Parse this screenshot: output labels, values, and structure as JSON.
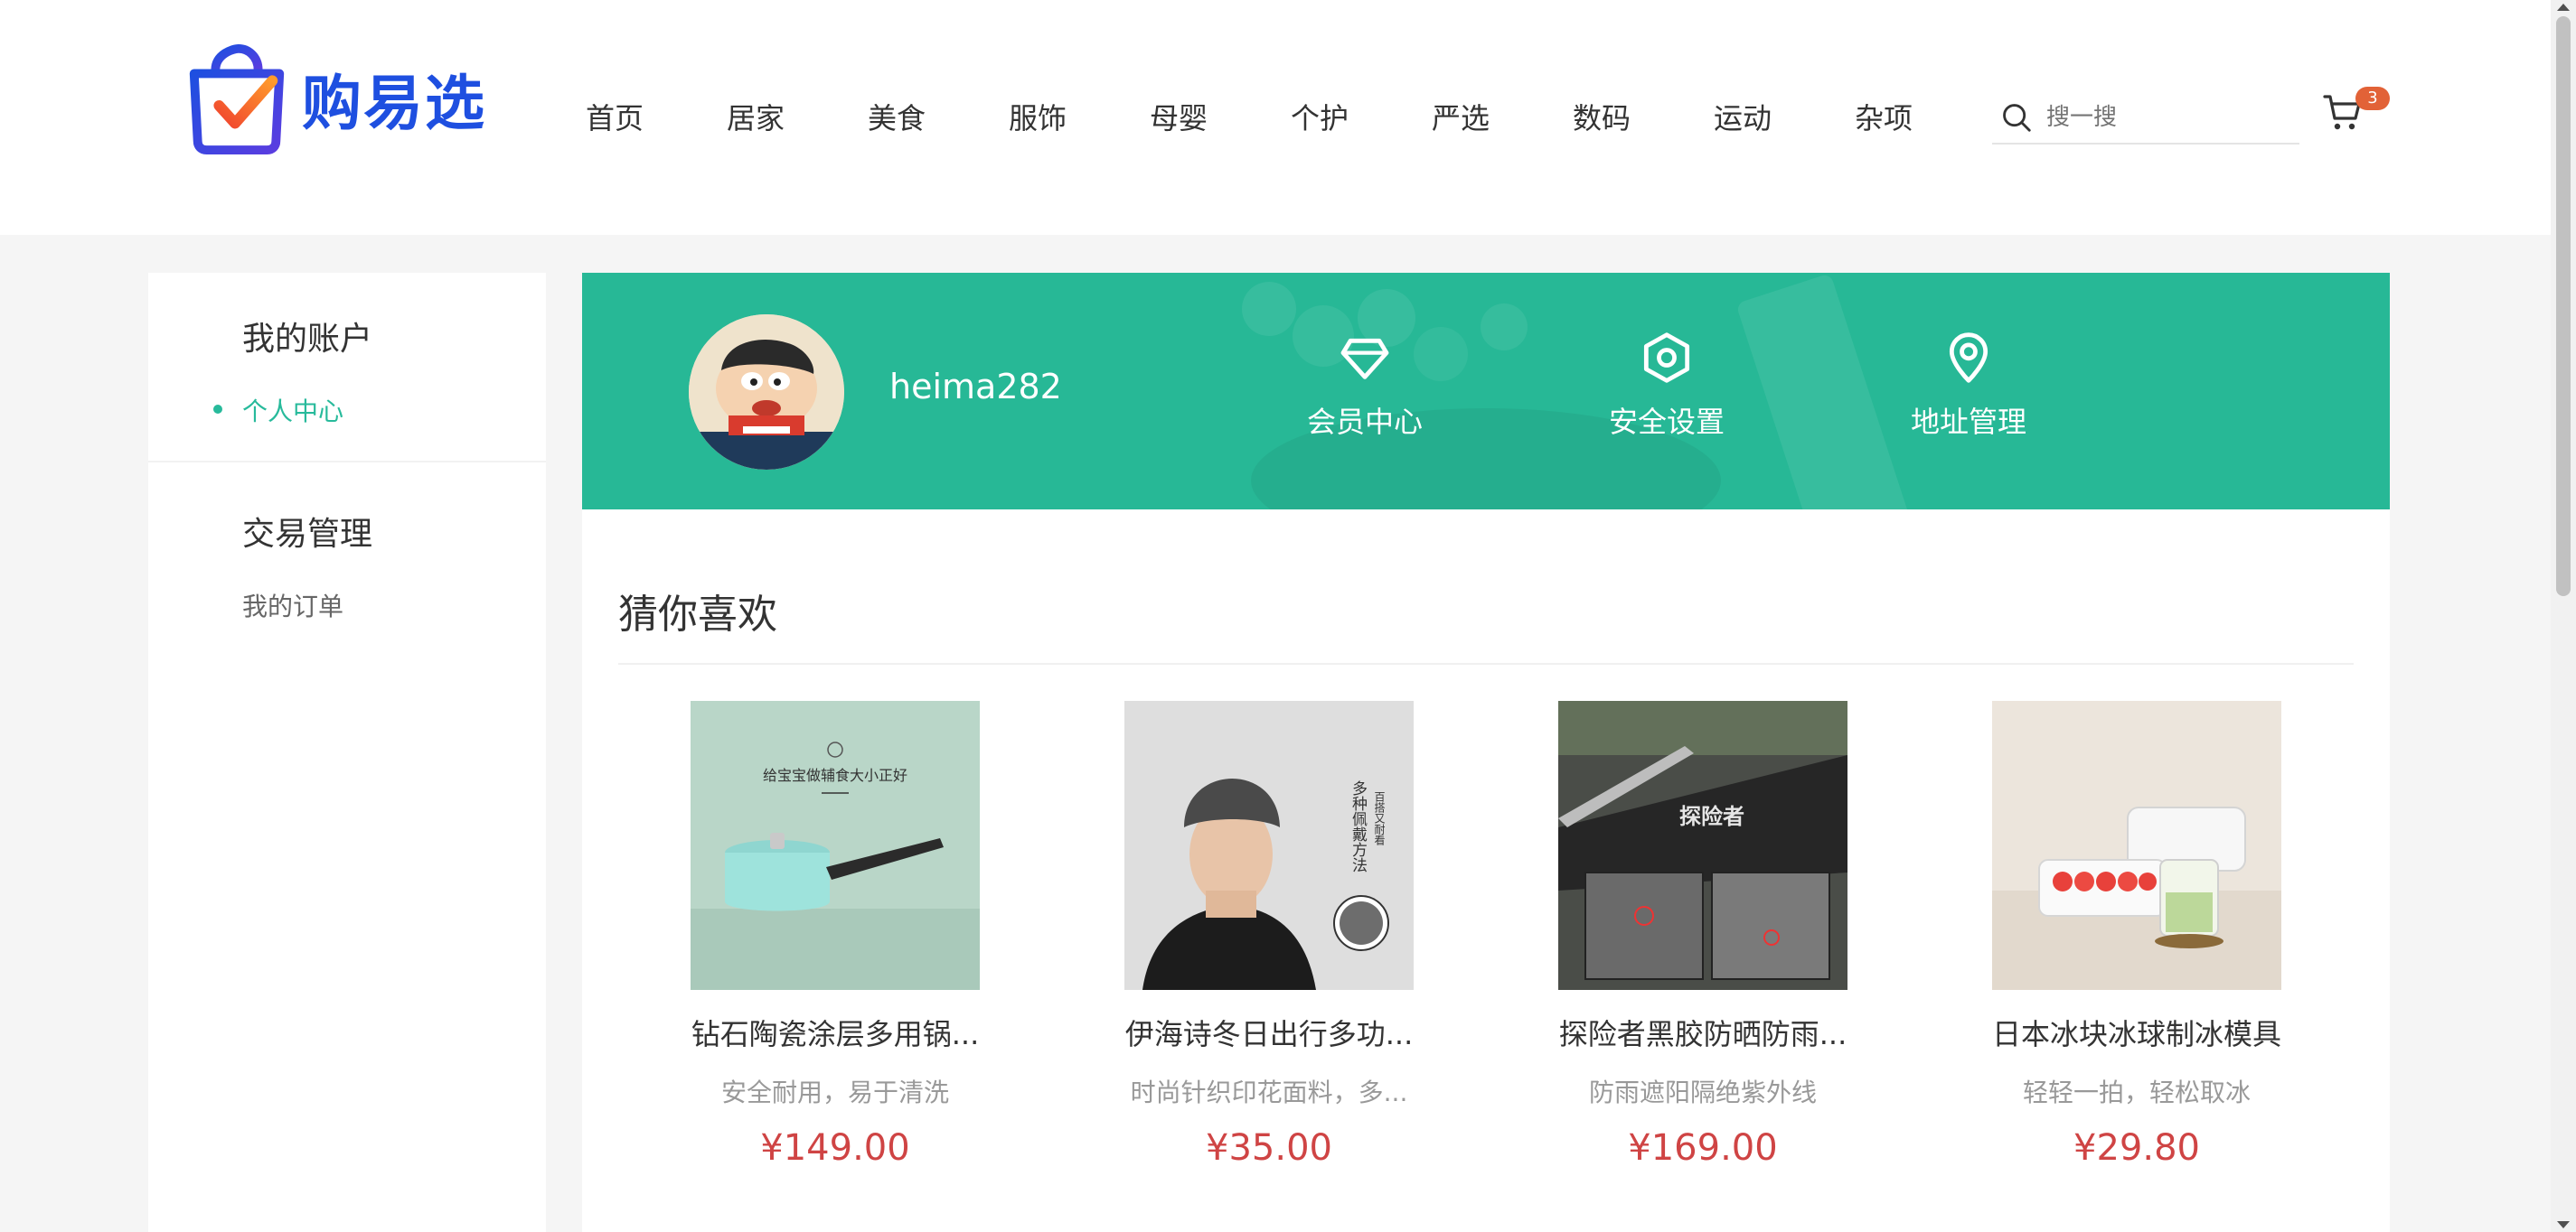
{
  "brand": {
    "name": "购易选"
  },
  "nav": [
    "首页",
    "居家",
    "美食",
    "服饰",
    "母婴",
    "个护",
    "严选",
    "数码",
    "运动",
    "杂项"
  ],
  "search": {
    "placeholder": "搜一搜"
  },
  "cart": {
    "count": "3"
  },
  "sidebar": {
    "groups": [
      {
        "title": "我的账户",
        "items": [
          {
            "label": "个人中心",
            "active": true
          }
        ]
      },
      {
        "title": "交易管理",
        "items": [
          {
            "label": "我的订单",
            "active": false
          }
        ]
      }
    ]
  },
  "profile": {
    "username": "heima282"
  },
  "banner_actions": [
    {
      "label": "会员中心",
      "icon": "diamond-icon"
    },
    {
      "label": "安全设置",
      "icon": "hexagon-shield-icon"
    },
    {
      "label": "地址管理",
      "icon": "location-pin-icon"
    }
  ],
  "guess": {
    "title": "猜你喜欢",
    "goods": [
      {
        "name": "钻石陶瓷涂层多用锅...",
        "desc": "安全耐用，易于清洗",
        "price": "¥149.00",
        "img_text": "给宝宝做辅食大小正好"
      },
      {
        "name": "伊海诗冬日出行多功...",
        "desc": "时尚针织印花面料，多...",
        "price": "¥35.00",
        "img_text": "多种佩戴方法",
        "img_text2": "百搭又耐看"
      },
      {
        "name": "探险者黑胶防晒防雨...",
        "desc": "防雨遮阳隔绝紫外线",
        "price": "¥169.00",
        "img_text": "探险者"
      },
      {
        "name": "日本冰块冰球制冰模具",
        "desc": "轻轻一拍，轻松取冰",
        "price": "¥29.80"
      }
    ]
  },
  "colors": {
    "brand_blue": "#1e4fe0",
    "accent_green": "#27b896",
    "price_red": "#cf4444",
    "badge": "#e26237"
  }
}
